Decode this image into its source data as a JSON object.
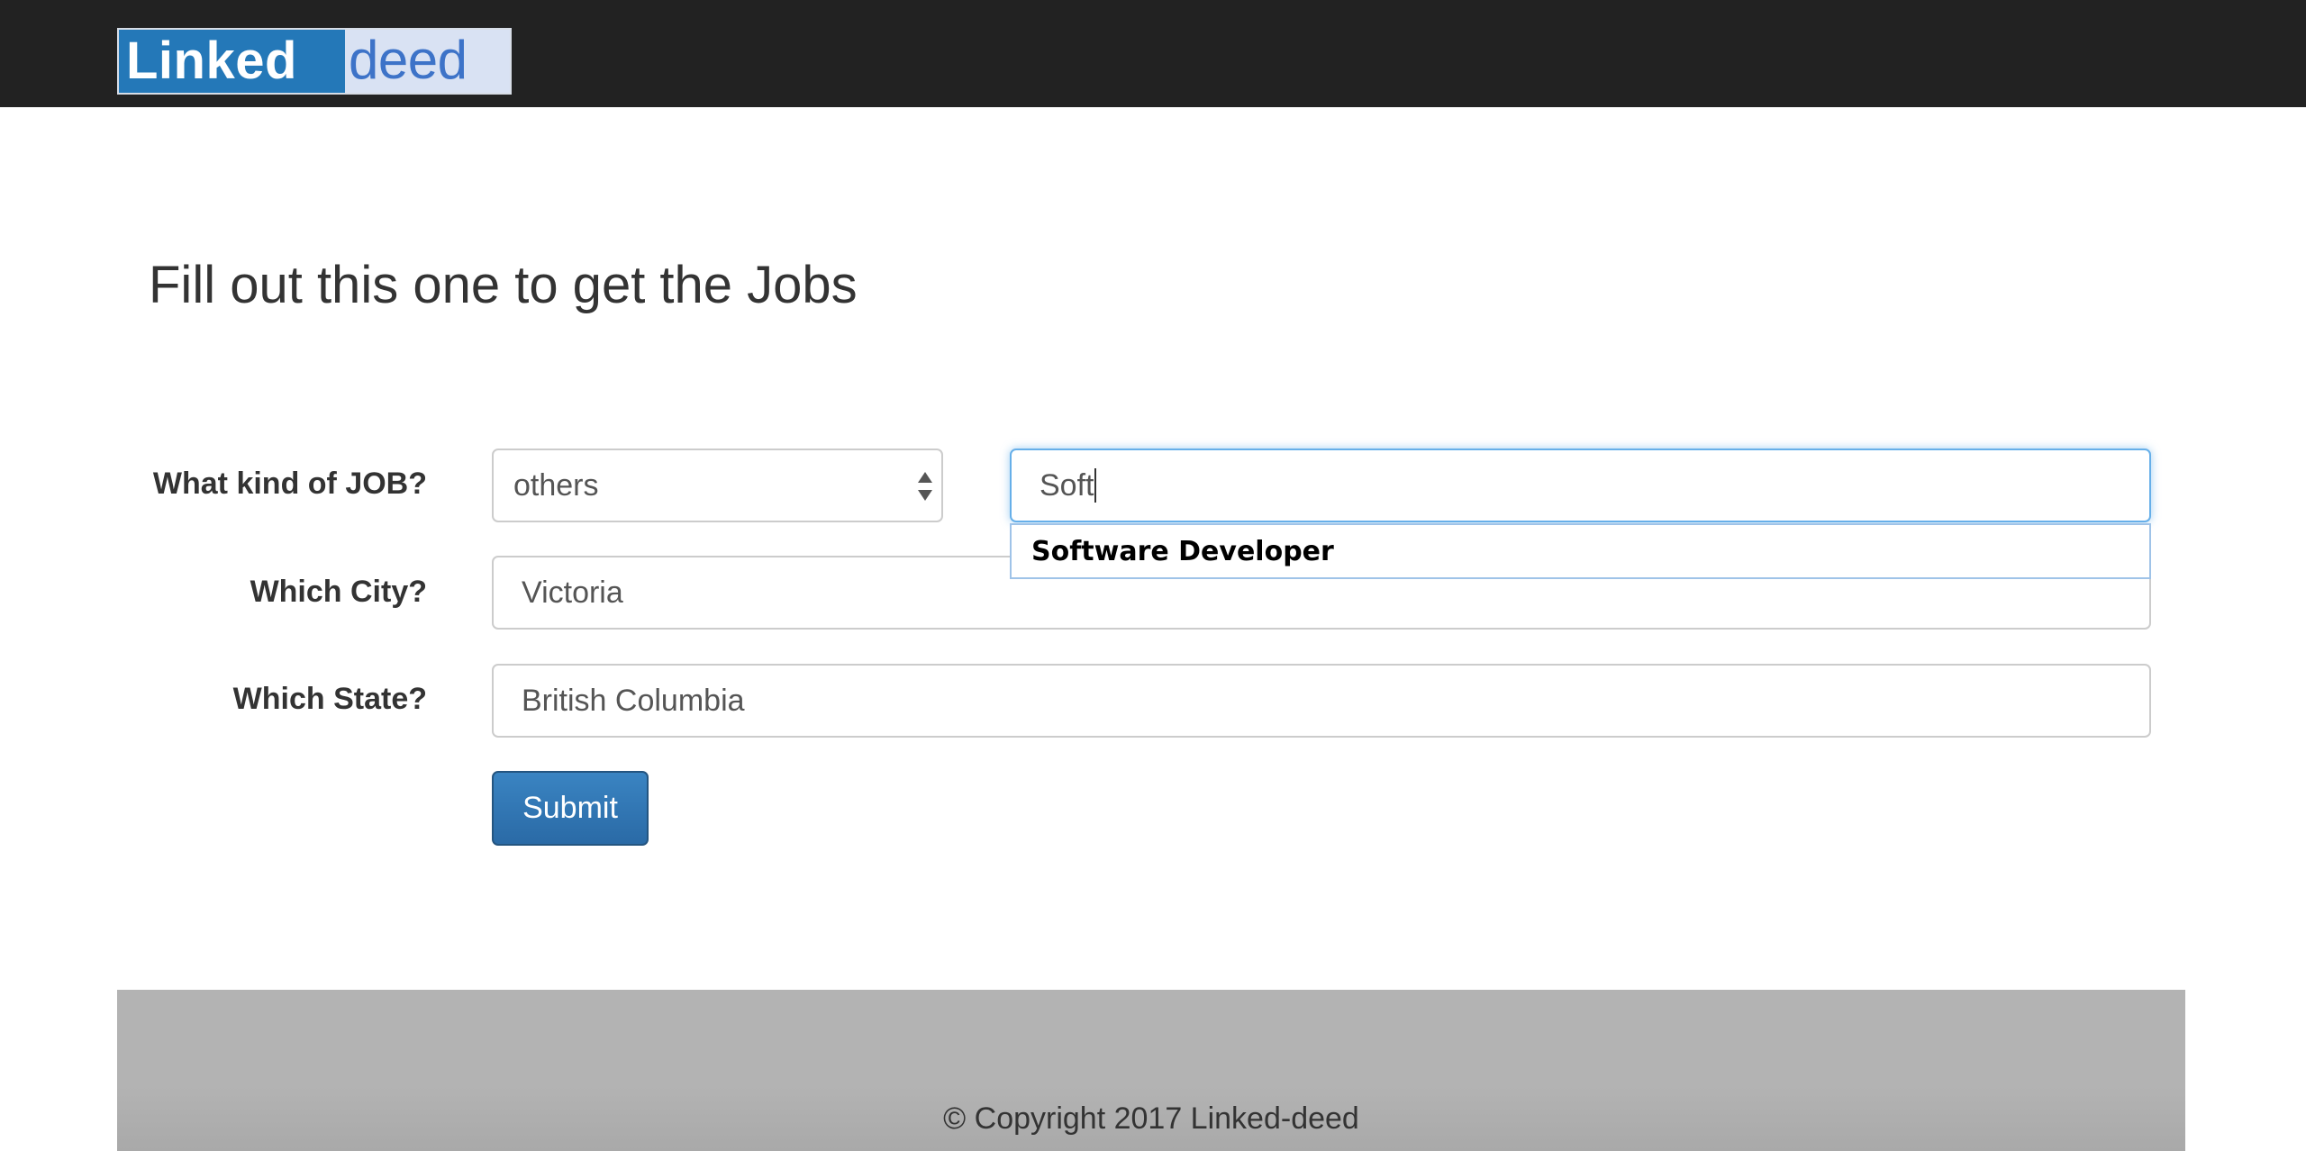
{
  "brand": {
    "part1": "Linked",
    "part2": "deed"
  },
  "page": {
    "title": "Fill out this one to get the Jobs"
  },
  "form": {
    "job_label": "What kind of JOB?",
    "job_category_value": "others",
    "job_title_value": "Soft",
    "suggestion": "Software Developer",
    "city_label": "Which City?",
    "city_value": "Victoria",
    "state_label": "Which State?",
    "state_value": "British Columbia",
    "submit_label": "Submit"
  },
  "footer": {
    "copyright": "© Copyright 2017 Linked-deed"
  },
  "colors": {
    "navbar": "#222222",
    "brand_blue": "#2478b8",
    "submit_blue": "#337ab7",
    "footer": "#b3b3b3"
  }
}
